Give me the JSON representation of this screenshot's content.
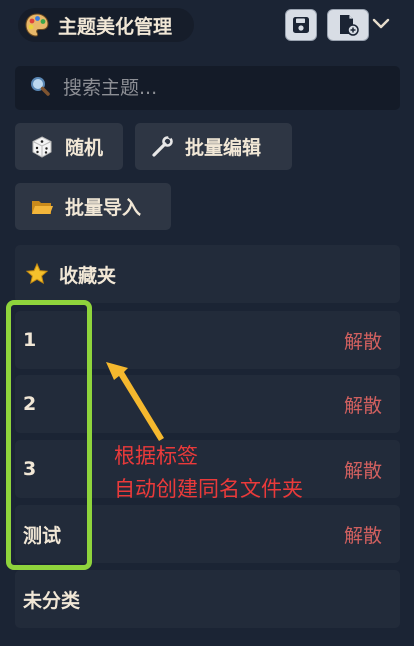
{
  "header": {
    "title": "主题美化管理",
    "save_icon": "save-icon",
    "new_file_icon": "file-add-icon",
    "menu_icon": "chevron-down-icon"
  },
  "search": {
    "placeholder": "搜索主题..."
  },
  "toolbar": {
    "random_label": "随机",
    "batch_edit_label": "批量编辑",
    "batch_import_label": "批量导入"
  },
  "groups": {
    "favorites_label": "收藏夹",
    "items": [
      {
        "label": "1",
        "action": "解散"
      },
      {
        "label": "2",
        "action": "解散"
      },
      {
        "label": "3",
        "action": "解散"
      },
      {
        "label": "测试",
        "action": "解散"
      }
    ],
    "uncategorized_label": "未分类"
  },
  "annotation": {
    "line1": "根据标签",
    "line2": "自动创建同名文件夹"
  },
  "colors": {
    "background": "#1b2434",
    "dissolve": "#d0605f",
    "highlight": "#8fd43c",
    "annotation": "#ea3a3a",
    "arrow": "#f5b82e"
  }
}
